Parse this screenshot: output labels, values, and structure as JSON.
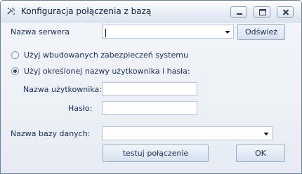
{
  "window": {
    "title": "Konfiguracja połączenia z bazą",
    "icons": {
      "app": "database-plug-icon",
      "minimize": "minimize-icon",
      "maximize": "maximize-icon",
      "close": "close-icon"
    }
  },
  "server": {
    "label": "Nazwa serwera",
    "value": "",
    "refresh_label": "Odśwież"
  },
  "auth": {
    "option_system": "Użyj wbudowanych zabezpieczeń systemu",
    "option_custom": "Użyj określonej nazwy użytkownika i hasła:",
    "selected": "custom",
    "username_label": "Nazwa użytkownika:",
    "username_value": "",
    "password_label": "Hasło:",
    "password_value": ""
  },
  "database": {
    "label": "Nazwa bazy danych:",
    "value": ""
  },
  "actions": {
    "test_label": "testuj połączenie",
    "ok_label": "OK"
  }
}
